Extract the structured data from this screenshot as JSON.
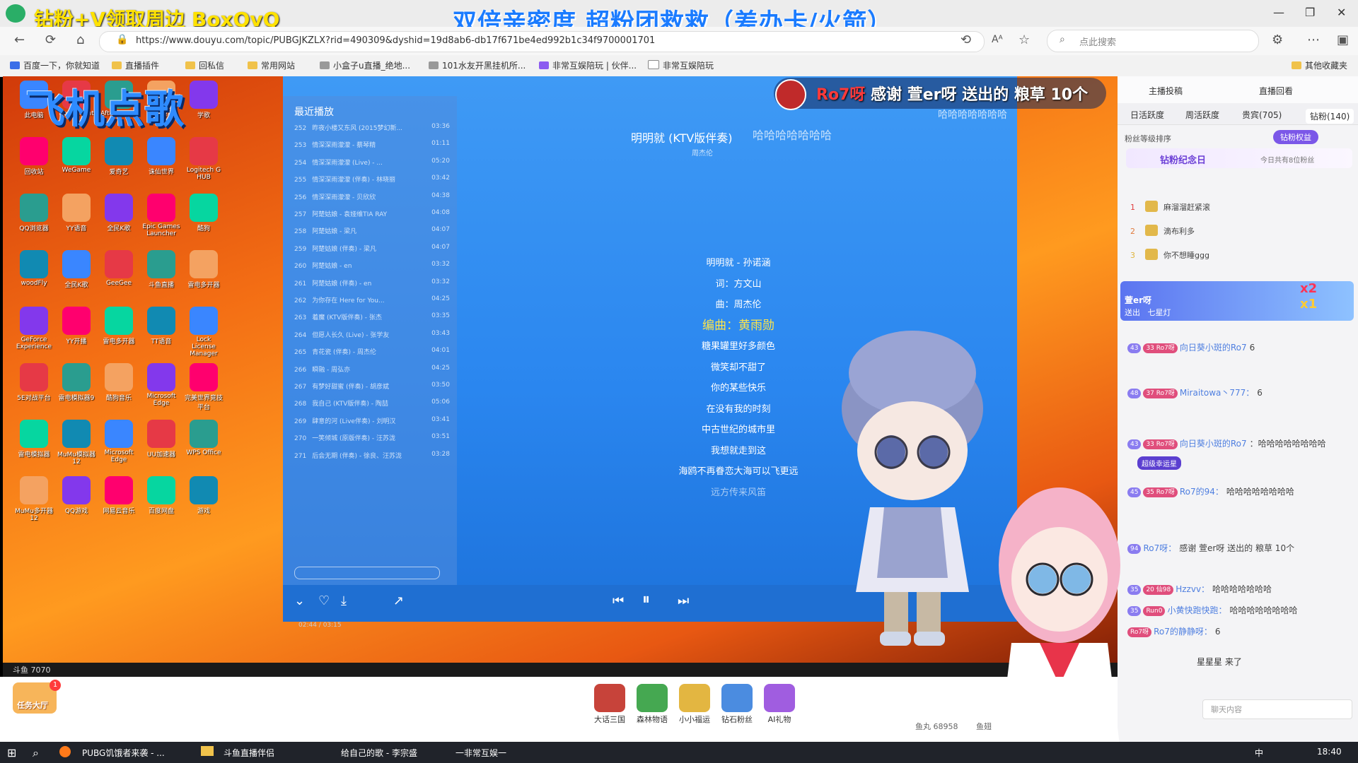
{
  "browser": {
    "promo_text": "钻粉+V领取周边 BoxQvQ",
    "banner_title": "双倍亲密度 超粉团救救（差办卡/火箭）",
    "url": "https://www.douyu.com/topic/PUBGJKZLX?rid=490309&dyshid=19d8ab6-db17f671be4ed992b1c34f9700001701",
    "search_placeholder": "点此搜索",
    "bookmarks": [
      "百度一下，你就知道",
      "直播插件",
      "回私信",
      "常用网站",
      "小盒子u直播_绝地...",
      "101水友开黑挂机所...",
      "非常互娱陪玩 | 伙伴...",
      "非常互娱陪玩",
      "其他收藏夹"
    ]
  },
  "stream": {
    "logo_text": "飞机点歌",
    "desktop_icons": [
      "此电脑",
      "Root Client",
      "Afterburner",
      "直播伴侣",
      "学歌",
      "回收站",
      "WeGame",
      "爱奇艺",
      "诛仙世界",
      "Logitech G HUB",
      "QQ浏览器",
      "YY语音",
      "全民K歌",
      "Epic Games Launcher",
      "酷狗",
      "woodFly",
      "全民K歌",
      "GeeGee",
      "斗鱼直播",
      "雷电多开器",
      "GeForce Experience",
      "YY开播",
      "雷电多开器",
      "TT语音",
      "Lock License Manager",
      "5E对战平台",
      "雷电模拟器9",
      "酷狗音乐",
      "Microsoft Edge",
      "完美世界竞技平台",
      "雷电模拟器",
      "MuMu模拟器12",
      "Microsoft Edge",
      "UU加速器",
      "WPS Office",
      "MuMu多开器12",
      "QQ游戏",
      "网易云音乐",
      "百度网盘",
      "游戏"
    ],
    "desktop_taskbar_text": "斗鱼 7070",
    "alert": {
      "name": "Ro7呀",
      "text": "感谢 萱er呀 送出的 粮草 10个",
      "sub": "哈哈哈哈哈哈哈"
    },
    "laugh_overlay": "哈哈哈哈哈哈哈",
    "player": {
      "recent_label": "最近播放",
      "song_title": "明明就 (KTV版伴奏)",
      "song_artist": "周杰伦",
      "playlist": [
        {
          "num": "252",
          "name": "昨夜小楼又东风 (2015梦幻新...",
          "time": "03:36"
        },
        {
          "num": "253",
          "name": "情深深雨濛濛 - 蔡琴精",
          "time": "01:11"
        },
        {
          "num": "254",
          "name": "情深深雨濛濛 (Live) - ...",
          "time": "05:20"
        },
        {
          "num": "255",
          "name": "情深深雨濛濛 (伴奏) - 林晓丽",
          "time": "03:42"
        },
        {
          "num": "256",
          "name": "情深深雨濛濛 - 贝欣欣",
          "time": "04:38"
        },
        {
          "num": "257",
          "name": "阿楚姑娘 - 袁娅维TIA RAY",
          "time": "04:08"
        },
        {
          "num": "258",
          "name": "阿楚姑娘 - 梁凡",
          "time": "04:07"
        },
        {
          "num": "259",
          "name": "阿楚姑娘 (伴奏) - 梁凡",
          "time": "04:07"
        },
        {
          "num": "260",
          "name": "阿楚姑娘 - en",
          "time": "03:32"
        },
        {
          "num": "261",
          "name": "阿楚姑娘 (伴奏) - en",
          "time": "03:32"
        },
        {
          "num": "262",
          "name": "为你存在 Here for You...",
          "time": "04:25"
        },
        {
          "num": "263",
          "name": "着魔 (KTV版伴奏) - 张杰",
          "time": "03:35"
        },
        {
          "num": "264",
          "name": "但愿人长久 (Live) - 张学友",
          "time": "03:43"
        },
        {
          "num": "265",
          "name": "青花瓷 (伴奏) - 周杰伦",
          "time": "04:01"
        },
        {
          "num": "266",
          "name": "瞬融 - 周弘亦",
          "time": "04:25"
        },
        {
          "num": "267",
          "name": "有梦好甜蜜 (伴奏) - 胡彦斌",
          "time": "03:50"
        },
        {
          "num": "268",
          "name": "我自己 (KTV版伴奏) - 陶喆",
          "time": "05:06"
        },
        {
          "num": "269",
          "name": "肆意的河 (Live伴奏) - 刘明汉",
          "time": "03:41"
        },
        {
          "num": "270",
          "name": "一笑倾城 (原版伴奏) - 汪苏泷",
          "time": "03:51"
        },
        {
          "num": "271",
          "name": "后会无期 (伴奏) - 徐良、汪苏泷",
          "time": "03:28"
        }
      ],
      "lyrics": [
        "明明就 - 孙诺涵",
        "词：方文山",
        "曲：周杰伦",
        "编曲：黄雨勋",
        "糖果罐里好多颜色",
        "微笑却不甜了",
        "你的某些快乐",
        "在没有我的时刻",
        "中古世纪的城市里",
        "我想就走到这",
        "海鸥不再眷恋大海可以飞更远",
        "远方传来风笛"
      ],
      "progress": "02:44 / 03:15"
    }
  },
  "sidebar": {
    "top_links": [
      "主播投稿",
      "直播回看"
    ],
    "tabs": [
      "日活跃度",
      "周活跃度",
      "贵宾(705)",
      "钻粉(140)"
    ],
    "rank_header": "粉丝等级排序",
    "diamond_rights": "钻粉权益",
    "diamond_day": "钻粉纪念日",
    "today_count": "今日共有8位粉丝",
    "ranks": [
      {
        "rank": "1",
        "name": "麻溜溜赶紧滚"
      },
      {
        "rank": "2",
        "name": "滴布利多"
      },
      {
        "rank": "3",
        "name": "你不想睡ggg"
      }
    ],
    "gift_banner": {
      "user": "萱er呀",
      "action": "送出",
      "item": "七星灯",
      "count1": "x2",
      "count2": "x1"
    },
    "chats": [
      {
        "lv": "43",
        "fan": "33 Ro7呀",
        "user": "向日葵小斑的Ro7",
        "text": "6"
      },
      {
        "lv": "48",
        "fan": "37 Ro7呀",
        "user": "Miraitowa丶777：",
        "text": "6"
      },
      {
        "lv": "43",
        "fan": "33 Ro7呀",
        "user": "向日葵小斑的Ro7",
        "text": "：哈哈哈哈哈哈哈哈"
      },
      {
        "lv": "45",
        "fan": "35 Ro7呀",
        "user": "Ro7的94：",
        "text": "哈哈哈哈哈哈哈哈"
      },
      {
        "lv": "94",
        "fan": "",
        "user": "Ro7呀：",
        "text": "感谢 萱er呀 送出的 粮草 10个"
      },
      {
        "lv": "35",
        "fan": "20 仙98",
        "user": "Hzzvv：",
        "text": "哈哈哈哈哈哈哈"
      },
      {
        "lv": "35",
        "fan": "Run0",
        "user": "小黄快跑快跑：",
        "text": "哈哈哈哈哈哈哈哈"
      },
      {
        "lv": "",
        "fan": "Ro7呀",
        "user": "Ro7的静静呀：",
        "text": "6"
      }
    ],
    "super_luck": "超级幸运星",
    "arrival": "星星星 来了",
    "input_placeholder": "聊天内容"
  },
  "bottom_bar": {
    "task_center": "任务大厅",
    "task_badge": "1",
    "activities": [
      "大话三国",
      "森林物语",
      "小小福运",
      "钻石粉丝",
      "AI礼物"
    ],
    "fish_ball": "鱼丸 68958",
    "fish_bean": "鱼翅"
  },
  "taskbar": {
    "apps": [
      "PUBG饥饿者来袭 - ...",
      "斗鱼直播伴侣",
      "给自己的歌 - 李宗盛",
      "一非常互娱一"
    ],
    "clock": "18:40",
    "ime": "中"
  }
}
